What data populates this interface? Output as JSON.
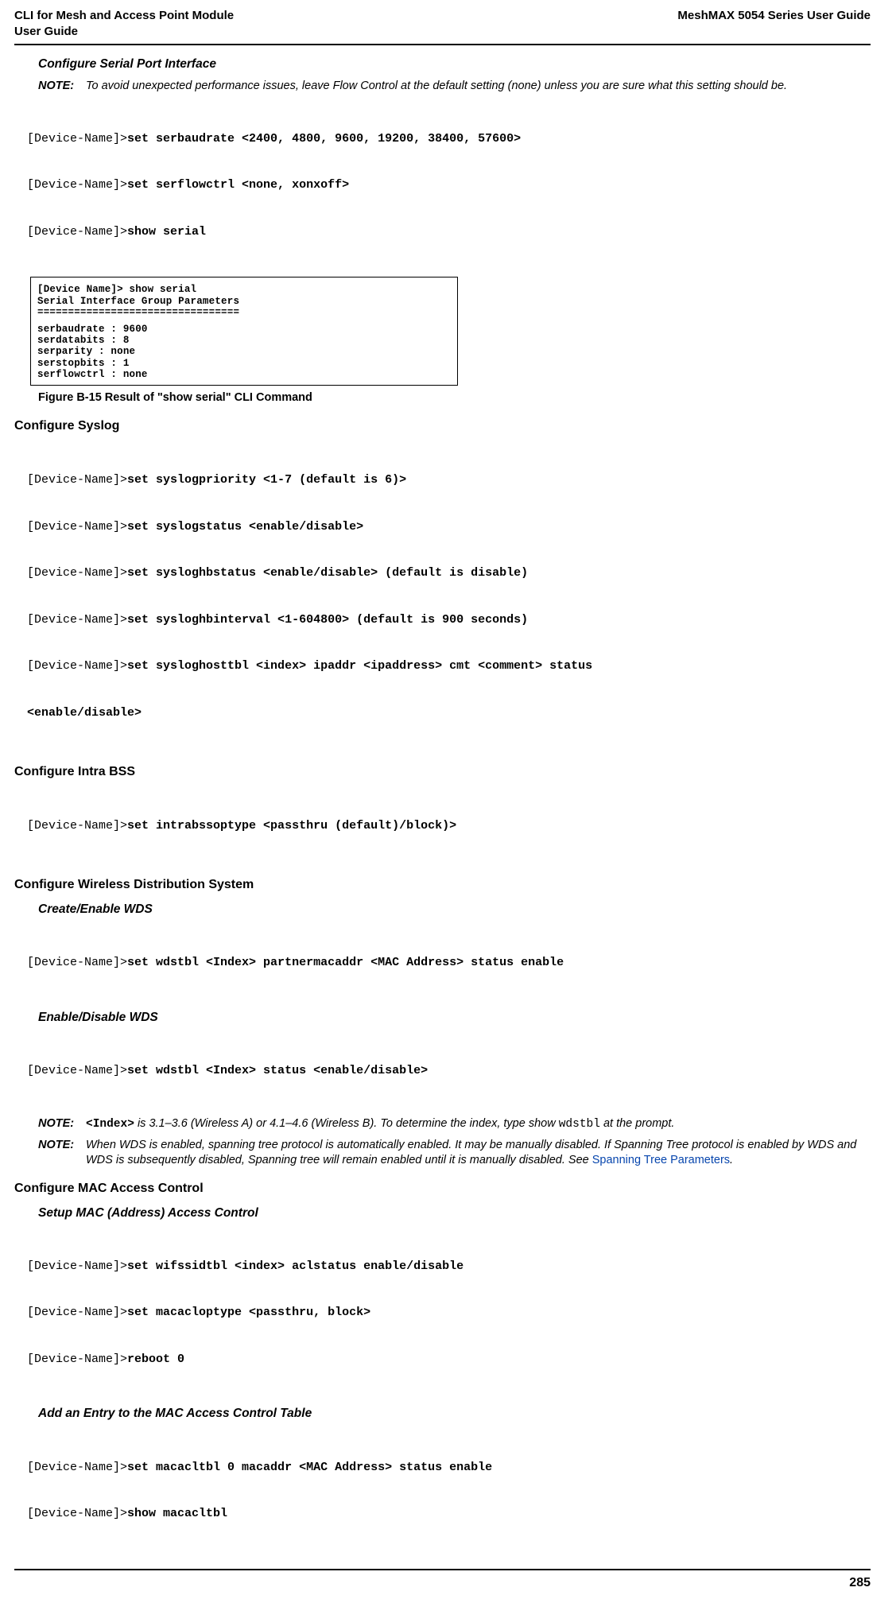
{
  "header": {
    "left": "CLI for Mesh and Access Point Module\n  User Guide",
    "right": "MeshMAX 5054 Series User Guide"
  },
  "sec_serial": {
    "title": "Configure Serial Port Interface",
    "note_label": "NOTE:",
    "note_body": "To avoid unexpected performance issues, leave Flow Control at the default setting (none) unless you are sure what this setting should be.",
    "cli": {
      "p1": "[Device-Name]>",
      "c1": "set serbaudrate <2400, 4800, 9600, 19200, 38400, 57600>",
      "p2": "[Device-Name]>",
      "c2": "set serflowctrl <none, xonxoff>",
      "p3": "[Device-Name]>",
      "c3": "show serial"
    },
    "term": {
      "l1": "[Device Name]> show serial",
      "l2": "Serial Interface Group Parameters",
      "l3": "=================================",
      "l4": "serbaudrate           :       9600",
      "l5": "serdatabits           :       8",
      "l6": "serparity             :       none",
      "l7": "serstopbits           :       1",
      "l8": "serflowctrl           :       none"
    },
    "caption": "Figure B-15 Result of \"show serial\" CLI Command"
  },
  "sec_syslog": {
    "title": "Configure Syslog",
    "cli": {
      "p1": "[Device-Name]>",
      "c1": "set syslogpriority <1-7 (default is 6)>",
      "p2": "[Device-Name]>",
      "c2": "set syslogstatus <enable/disable>",
      "p3": "[Device-Name]>",
      "c3": "set sysloghbstatus <enable/disable> (default is disable)",
      "p4": "[Device-Name]>",
      "c4": "set sysloghbinterval <1-604800> (default is 900 seconds)",
      "p5": "[Device-Name]>",
      "c5": "set sysloghosttbl <index> ipaddr <ipaddress> cmt <comment> status",
      "c6": "<enable/disable>"
    }
  },
  "sec_intrabss": {
    "title": "Configure Intra BSS",
    "cli": {
      "p1": "[Device-Name]>",
      "c1": "set intrabssoptype <passthru (default)/block)>"
    }
  },
  "sec_wds": {
    "title": "Configure Wireless Distribution System",
    "create_title": "Create/Enable WDS",
    "create_p1": "[Device-Name]>",
    "create_c1": "set wdstbl <Index> partnermacaddr <MAC Address> status enable",
    "enable_title": "Enable/Disable WDS",
    "enable_p1": "[Device-Name]>",
    "enable_c1": "set wdstbl <Index> status <enable/disable>",
    "note1_label": "NOTE:",
    "note1_pre": "<Index>",
    "note1_mid": " is 3.1–3.6 (Wireless A) or 4.1–4.6 (Wireless B). To determine the index, type show ",
    "note1_code": "wdstbl",
    "note1_post": " at the prompt.",
    "note2_label": "NOTE:",
    "note2_body_a": "When WDS is enabled, spanning tree protocol is automatically enabled. It may be manually disabled. If Spanning Tree protocol is enabled by WDS and WDS is subsequently disabled, Spanning tree will remain enabled until it is manually disabled. See ",
    "note2_link": "Spanning Tree Parameters",
    "note2_body_b": "."
  },
  "sec_mac": {
    "title": "Configure MAC Access Control",
    "setup_title": "Setup MAC (Address) Access Control",
    "setup_p1": "[Device-Name]>",
    "setup_c1": "set wifssidtbl <index> aclstatus enable/disable",
    "setup_p2": "[Device-Name]>",
    "setup_c2": "set macacloptype <passthru, block>",
    "setup_p3": "[Device-Name]>",
    "setup_c3": "reboot 0",
    "add_title": "Add an Entry to the MAC Access Control Table",
    "add_p1": "[Device-Name]>",
    "add_c1": "set macacltbl 0 macaddr <MAC Address> status enable",
    "add_p2": "[Device-Name]>",
    "add_c2": "show macacltbl"
  },
  "pagenum": "285"
}
